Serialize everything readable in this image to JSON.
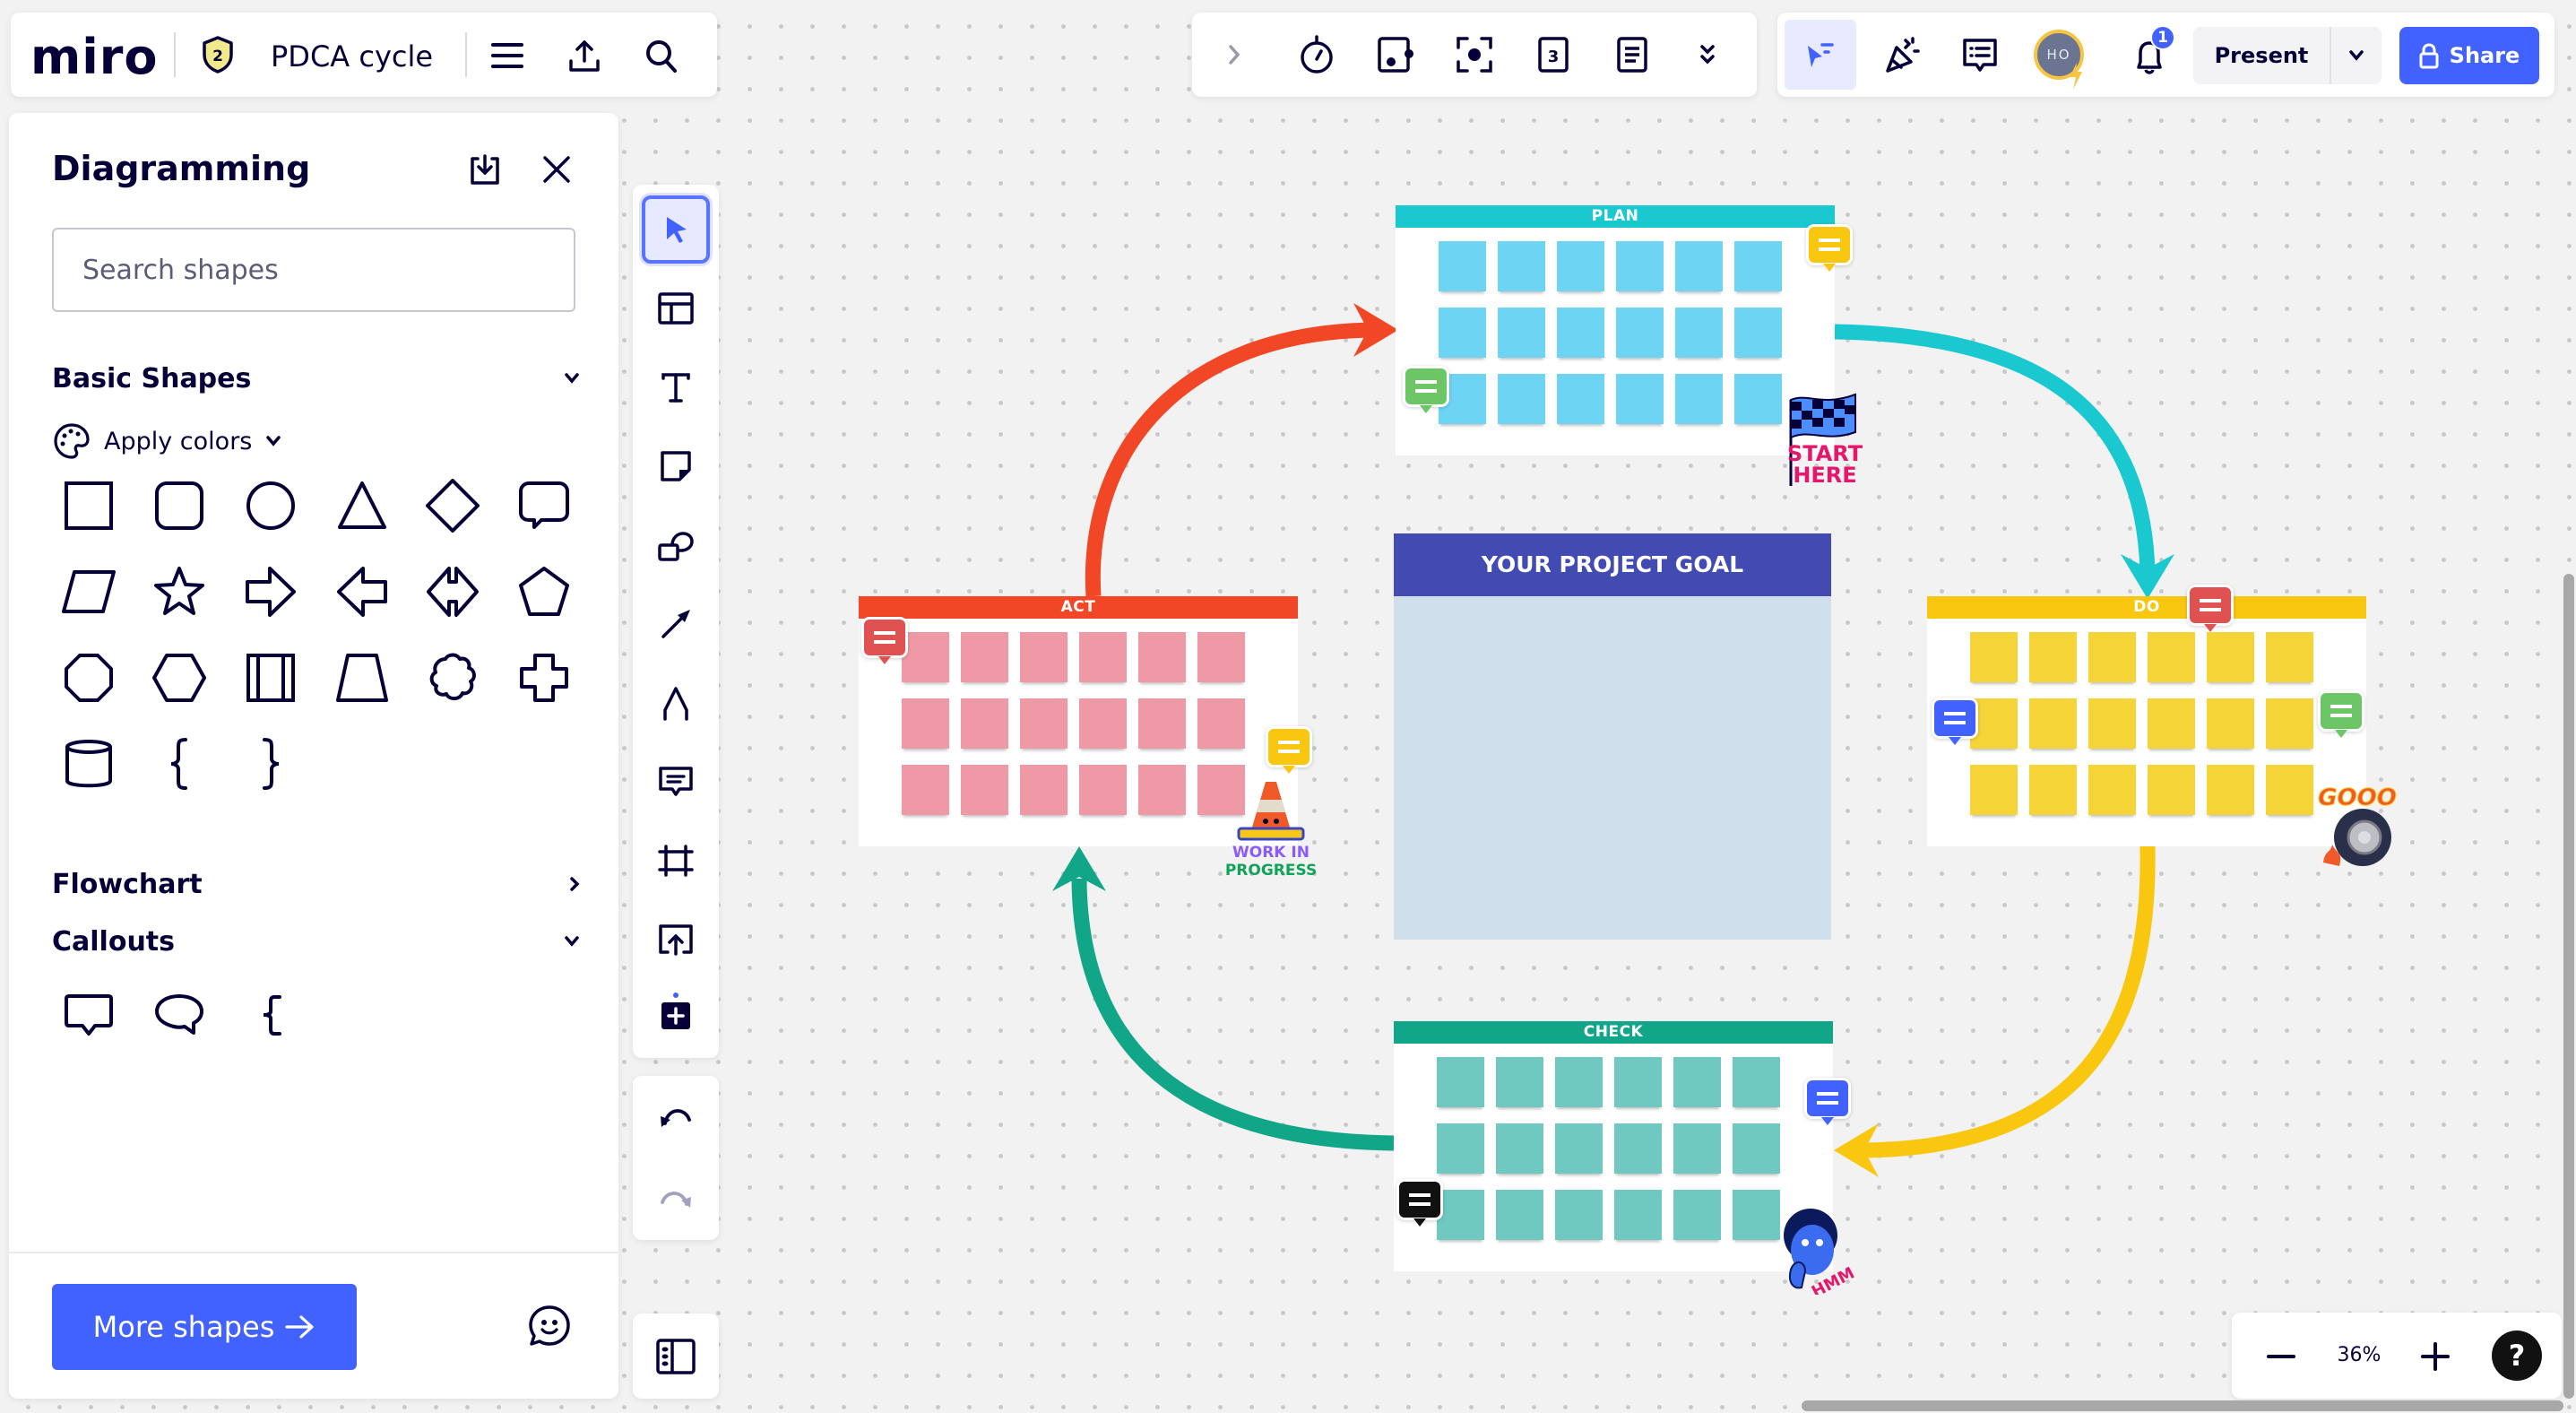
{
  "app": {
    "logo": "miro",
    "board_title": "PDCA cycle",
    "plan_badge": "2"
  },
  "top_left_bar": {
    "icons": [
      "menu-icon",
      "upload-icon",
      "search-icon"
    ]
  },
  "collab_toolbar": {
    "icons": [
      "expand-chevron-icon",
      "timer-icon",
      "voting-icon",
      "attention-icon",
      "cards-icon",
      "notes-icon",
      "more-icon"
    ]
  },
  "right_toolbar": {
    "avatar_initials": "HO",
    "notification_count": "1",
    "present_label": "Present",
    "share_label": "Share"
  },
  "panel": {
    "title": "Diagramming",
    "search_placeholder": "Search shapes",
    "search_value": "",
    "sections": {
      "basic": "Basic Shapes",
      "flowchart": "Flowchart",
      "callouts": "Callouts"
    },
    "apply_colors": "Apply colors",
    "basic_shapes": [
      "rectangle",
      "rounded-rectangle",
      "circle",
      "triangle",
      "rhombus",
      "speech-bubble",
      "parallelogram",
      "star",
      "arrow-right",
      "arrow-left",
      "arrow-double",
      "pentagon",
      "octagon",
      "hexagon",
      "predefined-process",
      "trapezoid",
      "cloud",
      "cross",
      "cylinder",
      "brace-left",
      "brace-right"
    ],
    "callout_shapes": [
      "callout-rectangle",
      "callout-oval",
      "callout-brace"
    ],
    "more_shapes_label": "More shapes"
  },
  "vertical_toolbar": {
    "tools": [
      "select",
      "templates",
      "text",
      "sticky-note",
      "shapes",
      "connection-line",
      "pen",
      "comment",
      "frame",
      "upload",
      "more-apps"
    ],
    "active_tool": "select"
  },
  "canvas": {
    "goal_title": "YOUR PROJECT GOAL",
    "frames": [
      {
        "id": "plan",
        "title": "PLAN",
        "header_color": "#1ac9d0",
        "note_color": "#6dd4f4",
        "notes_count": 18,
        "sticker": "START HERE"
      },
      {
        "id": "do",
        "title": "DO",
        "header_color": "#fac710",
        "note_color": "#f5d438",
        "notes_count": 18,
        "sticker": "GOOO"
      },
      {
        "id": "check",
        "title": "CHECK",
        "header_color": "#12a689",
        "note_color": "#6fc9c0",
        "notes_count": 18,
        "sticker": "HMM"
      },
      {
        "id": "act",
        "title": "ACT",
        "header_color": "#f24726",
        "note_color": "#ef99a6",
        "notes_count": 18,
        "sticker": "WORK IN PROGRESS"
      }
    ],
    "comments": [
      {
        "frame": "plan",
        "color": "#fac710"
      },
      {
        "frame": "plan",
        "color": "#6cc666"
      },
      {
        "frame": "act",
        "color": "#e05252"
      },
      {
        "frame": "act",
        "color": "#fac710"
      },
      {
        "frame": "do",
        "color": "#e05252"
      },
      {
        "frame": "do",
        "color": "#4262ff"
      },
      {
        "frame": "do",
        "color": "#6cc666"
      },
      {
        "frame": "check",
        "color": "#4262ff"
      },
      {
        "frame": "check",
        "color": "#111111"
      }
    ]
  },
  "zoom": {
    "level": "36%",
    "help": "?"
  }
}
